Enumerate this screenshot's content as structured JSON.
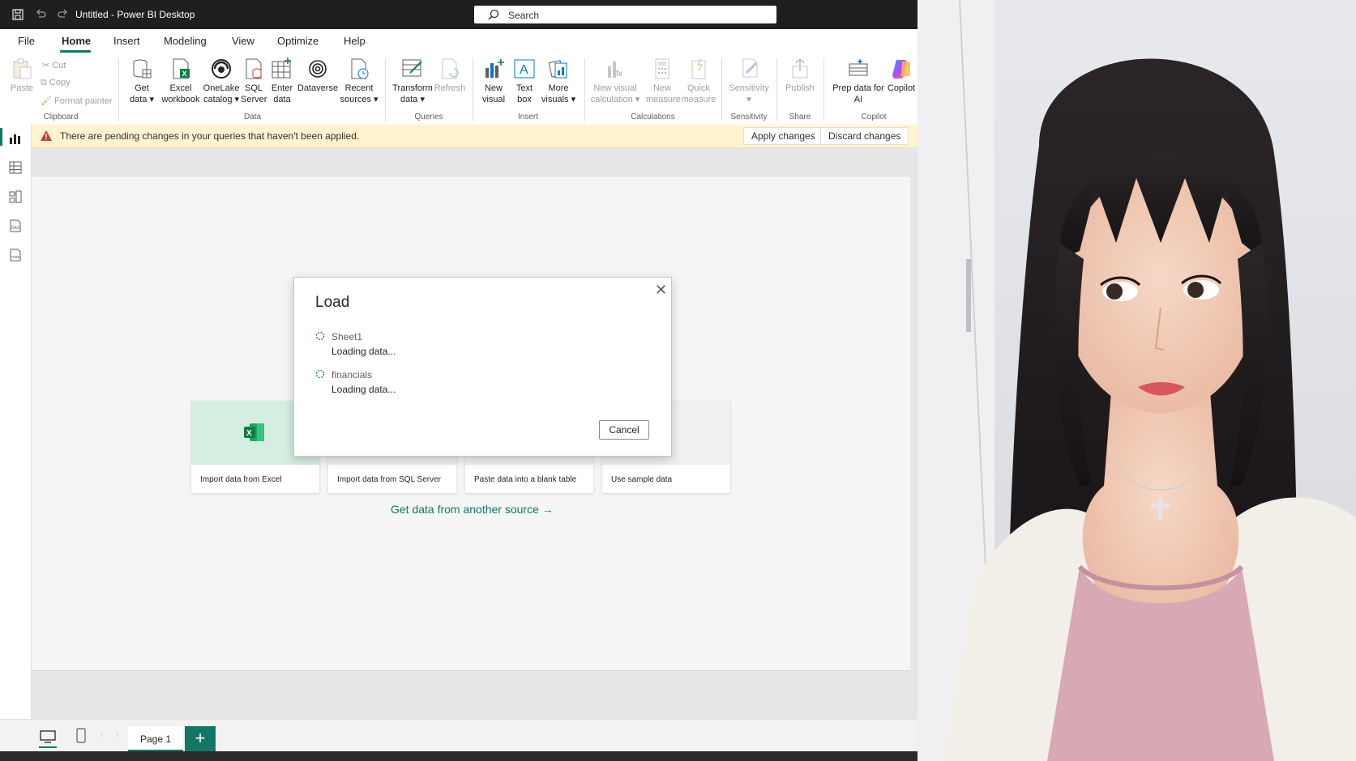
{
  "titlebar": {
    "title": "Untitled - Power BI Desktop",
    "search_label": "Search"
  },
  "menu": [
    "File",
    "Home",
    "Insert",
    "Modeling",
    "View",
    "Optimize",
    "Help"
  ],
  "ribbon": {
    "clipboard": {
      "paste": "Paste",
      "cut": "Cut",
      "copy": "Copy",
      "format_painter": "Format painter",
      "group": "Clipboard"
    },
    "data": {
      "get_data": [
        "Get",
        "data ▾"
      ],
      "excel": [
        "Excel",
        "workbook"
      ],
      "onelake": [
        "OneLake",
        "catalog ▾"
      ],
      "sql": [
        "SQL",
        "Server"
      ],
      "enter": [
        "Enter",
        "data"
      ],
      "dataverse": [
        "Dataverse",
        ""
      ],
      "recent": [
        "Recent",
        "sources ▾"
      ],
      "group": "Data"
    },
    "queries": {
      "transform": [
        "Transform",
        "data ▾"
      ],
      "refresh": [
        "Refresh",
        ""
      ],
      "group": "Queries"
    },
    "insert": {
      "new_visual": [
        "New",
        "visual"
      ],
      "text_box": [
        "Text",
        "box"
      ],
      "more_visuals": [
        "More",
        "visuals ▾"
      ],
      "group": "Insert"
    },
    "calculations": {
      "new_visual_calc": [
        "New visual",
        "calculation ▾"
      ],
      "new_measure": [
        "New",
        "measure"
      ],
      "quick_measure": [
        "Quick",
        "measure"
      ],
      "group": "Calculations"
    },
    "sensitivity": {
      "label": [
        "Sensitivity",
        "▾"
      ],
      "group": "Sensitivity"
    },
    "share": {
      "publish": [
        "Publish",
        ""
      ],
      "group": "Share"
    },
    "copilot": {
      "prep": [
        "Prep data for",
        "AI"
      ],
      "copilot": [
        "Copilot",
        ""
      ],
      "group": "Copilot"
    }
  },
  "notification": {
    "message": "There are pending changes in your queries that haven't been applied.",
    "apply": "Apply changes",
    "discard": "Discard changes"
  },
  "cards": [
    {
      "label": "Import data from Excel"
    },
    {
      "label": "Import data from SQL Server"
    },
    {
      "label": "Paste data into a blank table"
    },
    {
      "label": "Use sample data"
    }
  ],
  "get_other": "Get data from another source →",
  "dialog": {
    "title": "Load",
    "items": [
      {
        "name": "Sheet1",
        "status": "Loading data..."
      },
      {
        "name": "financials",
        "status": "Loading data..."
      }
    ],
    "cancel": "Cancel"
  },
  "bottom": {
    "page_tab": "Page 1",
    "add": "+"
  },
  "colors": {
    "accent": "#117865",
    "excel_green": "#107c41",
    "warning": "#d13438"
  }
}
